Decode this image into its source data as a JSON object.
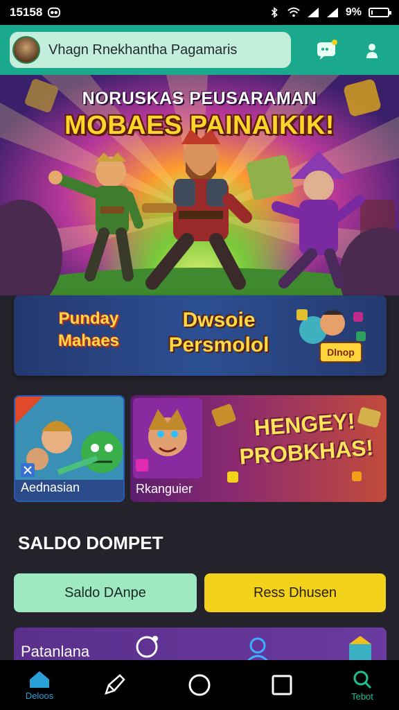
{
  "status_bar": {
    "time": "15158",
    "battery": "9%",
    "battery_level": 0.09
  },
  "header": {
    "search_text": "Vhagn Rnekhantha  Pagamaris",
    "icons": [
      "avatar",
      "chat-icon",
      "user-icon"
    ]
  },
  "hero": {
    "title_top": "NORUSKAS PEUSARAMAN",
    "title_main": "MOBAES PAINAIKIK!"
  },
  "promo_banner": {
    "left_text": "Punday Mahaes",
    "middle_text": "Dwsoie Persmolol",
    "badge_text": "Dlnop"
  },
  "cards": [
    {
      "label": "Aednasian",
      "corner_icon": "close-icon"
    },
    {
      "label": "Rkanguier",
      "promo_text": "HENGEY! PROBKHAS!"
    }
  ],
  "wallet": {
    "title": "SALDO DOMPET",
    "buttons": [
      "Saldo DAnpe",
      "Ress Dhusen"
    ]
  },
  "bottom_card": {
    "label": "Patanlana"
  },
  "navbar": {
    "left_label": "Deloos",
    "right_label": "Tebot"
  },
  "colors": {
    "header": "#1aa98c",
    "wallet_left": "#9ee8c2",
    "wallet_right": "#f2d21a",
    "accent_green": "#1fbf95"
  }
}
